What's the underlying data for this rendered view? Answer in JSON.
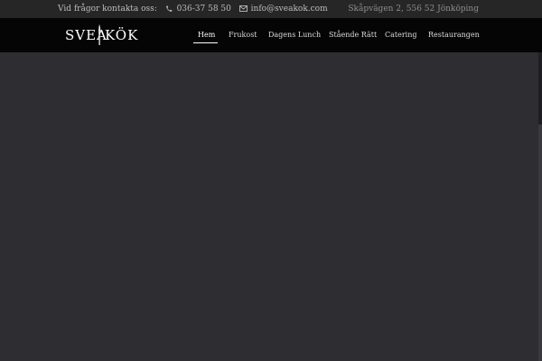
{
  "topbar": {
    "contact_label": "Vid frågor kontakta oss:",
    "phone": "036-37 58 50",
    "email": "info@sveakok.com",
    "address": "Skåpvägen 2, 556 52 Jönköping"
  },
  "logo": {
    "word1": "SVEA",
    "word2": "KÖK"
  },
  "nav": {
    "items": [
      {
        "label": "Hem",
        "active": true
      },
      {
        "label": "Frukost"
      },
      {
        "label": "Dagens Lunch"
      },
      {
        "label": "Stående Rätt"
      },
      {
        "label": "Catering"
      },
      {
        "label": "Restaurangen"
      }
    ]
  },
  "colors": {
    "topbar_bg": "#262626",
    "navbar_bg": "#050505",
    "hero_bg": "#2e2e32",
    "text": "#bdbdbd"
  }
}
